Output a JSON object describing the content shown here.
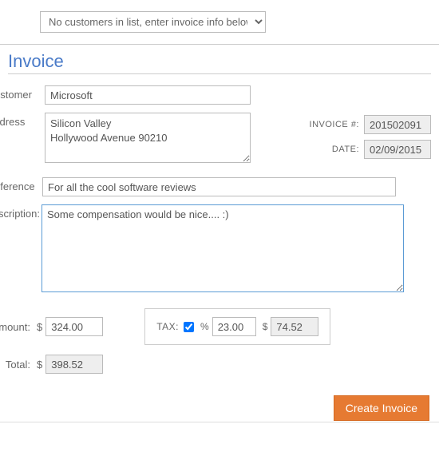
{
  "dropdown": {
    "selected": "No customers in list, enter invoice info below"
  },
  "heading": "Invoice",
  "meta": {
    "invoice_label": "INVOICE #:",
    "invoice_value": "201502091",
    "date_label": "DATE:",
    "date_value": "02/09/2015"
  },
  "labels": {
    "customer": "Customer:",
    "address": "Address:",
    "reference": "Reference:",
    "description": "Description:",
    "amount": "Amount:",
    "total": "Total:",
    "tax": "TAX:",
    "currency": "$",
    "percent": "%"
  },
  "values": {
    "customer": "Microsoft",
    "address": "Silicon Valley\nHollywood Avenue 90210",
    "reference": "For all the cool software reviews",
    "description": "Some compensation would be nice.... :)",
    "amount": "324.00",
    "tax_checked": true,
    "tax_percent": "23.00",
    "tax_amount": "74.52",
    "total": "398.52"
  },
  "buttons": {
    "create": "Create Invoice"
  }
}
